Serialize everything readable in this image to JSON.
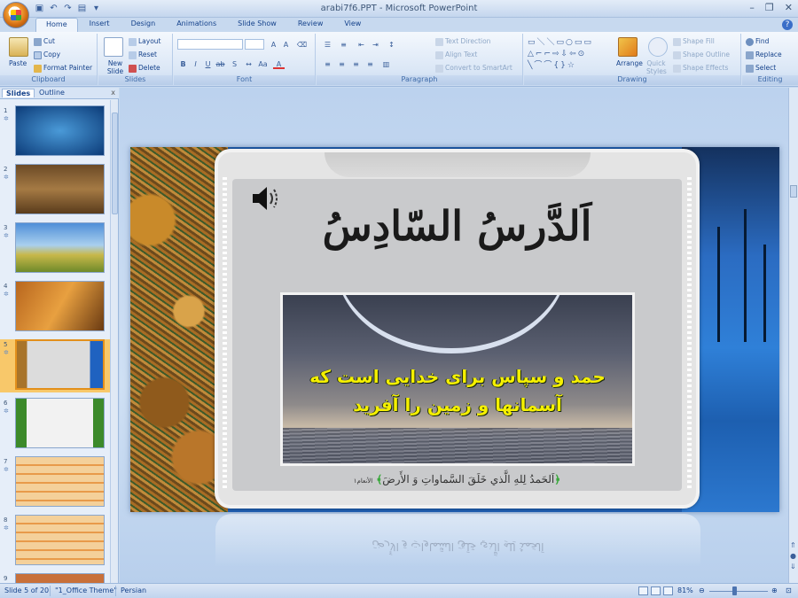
{
  "window": {
    "title": "arabi7f6.PPT - Microsoft PowerPoint",
    "controls": [
      "minimize",
      "restore",
      "close"
    ]
  },
  "ribbon_tabs": [
    "Home",
    "Insert",
    "Design",
    "Animations",
    "Slide Show",
    "Review",
    "View"
  ],
  "active_tab": "Home",
  "ribbon": {
    "clipboard": {
      "label": "Clipboard",
      "paste": "Paste",
      "cut": "Cut",
      "copy": "Copy",
      "format_painter": "Format Painter"
    },
    "slides": {
      "label": "Slides",
      "new_slide": "New Slide",
      "layout": "Layout",
      "reset": "Reset",
      "delete": "Delete"
    },
    "font": {
      "label": "Font"
    },
    "paragraph": {
      "label": "Paragraph",
      "text_direction": "Text Direction",
      "align_text": "Align Text",
      "convert_smartart": "Convert to SmartArt"
    },
    "drawing": {
      "label": "Drawing",
      "arrange": "Arrange",
      "quick_styles": "Quick Styles",
      "shape_fill": "Shape Fill",
      "shape_outline": "Shape Outline",
      "shape_effects": "Shape Effects"
    },
    "editing": {
      "label": "Editing",
      "find": "Find",
      "replace": "Replace",
      "select": "Select"
    }
  },
  "pane": {
    "tabs": [
      "Slides",
      "Outline"
    ],
    "active_tab": "Slides",
    "close": "x",
    "thumbnails": [
      {
        "num": "1"
      },
      {
        "num": "2"
      },
      {
        "num": "3"
      },
      {
        "num": "4"
      },
      {
        "num": "5",
        "selected": true
      },
      {
        "num": "6"
      },
      {
        "num": "7"
      },
      {
        "num": "8"
      },
      {
        "num": "9"
      }
    ]
  },
  "slide": {
    "heading": "اَلدَّرسُ السّادِسُ",
    "persian_line1": "حمد و سپاس برای خدایی است که",
    "persian_line2": "آسمانها و زمین را آفرید",
    "verse": "اَلحَمدُ لِلهِ الَّذي خَلَقَ السَّماواتِ وَ الأَرضَ",
    "verse_ref": "الأنعام١"
  },
  "status": {
    "slide_info": "Slide 5 of 20",
    "theme": "\"1_Office Theme\"",
    "language": "Persian",
    "zoom": "81%"
  },
  "colors": {
    "persian_text": "#f5f000",
    "verse_brackets": "#38a83a",
    "selection": "#f8c86a"
  }
}
